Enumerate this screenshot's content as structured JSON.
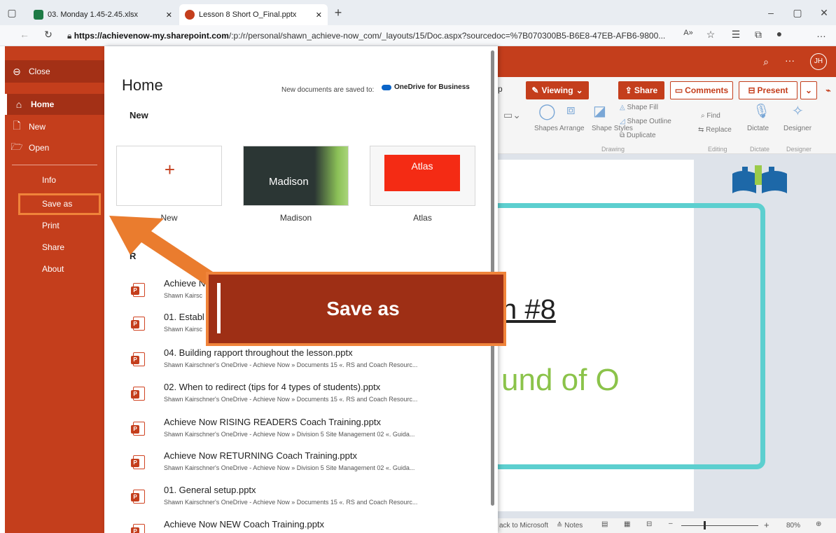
{
  "browser": {
    "tabs": [
      {
        "label": "03. Monday 1.45-2.45.xlsx",
        "icon": "excel-icon"
      },
      {
        "label": "Lesson 8 Short O_Final.pptx",
        "icon": "powerpoint-icon"
      }
    ],
    "url_host": "https://achievenow-my.sharepoint.com",
    "url_path": "/:p:/r/personal/shawn_achieve-now_com/_layouts/15/Doc.aspx?sourcedoc=%7B070300B5-B6E8-47EB-AFB6-9800...",
    "window_controls": [
      "–",
      "▢",
      "✕"
    ]
  },
  "sidebar": {
    "close": "Close",
    "items": [
      {
        "label": "Home",
        "icon": "home-icon"
      },
      {
        "label": "New",
        "icon": "new-file-icon"
      },
      {
        "label": "Open",
        "icon": "folder-open-icon"
      },
      {
        "label": "Info"
      },
      {
        "label": "Save as"
      },
      {
        "label": "Print"
      },
      {
        "label": "Share"
      },
      {
        "label": "About"
      }
    ]
  },
  "panel": {
    "title": "Home",
    "save_note": "New documents are saved to:",
    "save_location": "OneDrive for Business",
    "new_heading": "New",
    "recent_heading": "R",
    "templates": [
      {
        "caption": "New",
        "thumb": "+"
      },
      {
        "caption": "Madison",
        "thumb": "Madison"
      },
      {
        "caption": "Atlas",
        "thumb": "Atlas"
      }
    ],
    "files": [
      {
        "name": "Achieve N",
        "path": "Shawn Kairsc"
      },
      {
        "name": "01. Establ",
        "path": "Shawn Kairsc"
      },
      {
        "name": "04. Building rapport throughout the lesson.pptx",
        "path": "Shawn Kairschner's OneDrive - Achieve Now » Documents 15 «. RS and Coach Resourc..."
      },
      {
        "name": "02. When to redirect (tips for 4 types of students).pptx",
        "path": "Shawn Kairschner's OneDrive - Achieve Now » Documents 15 «. RS and Coach Resourc..."
      },
      {
        "name": "Achieve Now RISING READERS Coach Training.pptx",
        "path": "Shawn Kairschner's OneDrive - Achieve Now » Division 5 Site Management 02 «. Guida..."
      },
      {
        "name": "Achieve Now RETURNING Coach Training.pptx",
        "path": "Shawn Kairschner's OneDrive - Achieve Now » Division 5 Site Management 02 «. Guida..."
      },
      {
        "name": "01. General setup.pptx",
        "path": "Shawn Kairschner's OneDrive - Achieve Now » Documents 15 «. RS and Coach Resourc..."
      },
      {
        "name": "Achieve Now NEW Coach Training.pptx",
        "path": ""
      }
    ]
  },
  "app": {
    "user_initials": "JH",
    "ribbon_cut": "p",
    "viewing": "Viewing",
    "share": "Share",
    "comments": "Comments",
    "present": "Present",
    "groups": {
      "shapes": "Shapes",
      "arrange": "Arrange",
      "shape_styles": "Shape Styles",
      "shape_fill": "Shape Fill",
      "shape_outline": "Shape Outline",
      "duplicate": "Duplicate",
      "drawing": "Drawing",
      "find": "Find",
      "replace": "Replace",
      "editing": "Editing",
      "dictate": "Dictate",
      "designer": "Designer"
    },
    "slide_line1": "n #8",
    "slide_line2": "und of O",
    "status": {
      "back": "ack to Microsoft",
      "notes": "Notes",
      "zoom": "80%"
    },
    "accent": "#c43e1c"
  },
  "callout": {
    "text": "Save as",
    "accent": "#f0843a"
  }
}
